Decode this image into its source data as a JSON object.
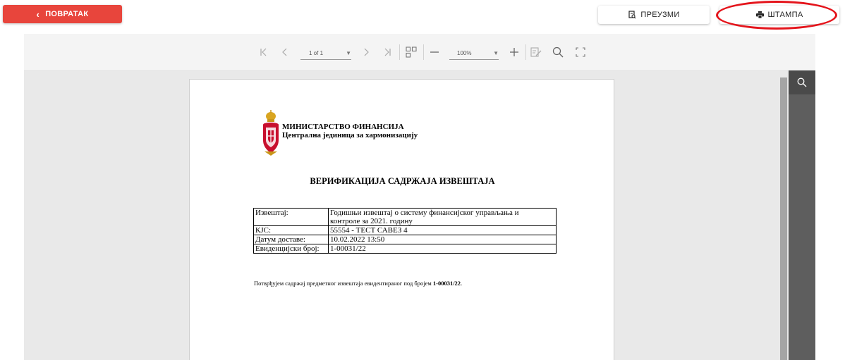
{
  "header": {
    "back_label": "ПОВРАТАК",
    "download_label": "ПРЕУЗМИ",
    "print_label": "ШТАМПА"
  },
  "toolbar": {
    "page_indicator": "1 of 1",
    "zoom_level": "100%",
    "icons": [
      "first-page-icon",
      "prev-page-icon",
      "next-page-icon",
      "last-page-icon",
      "thumbnails-icon",
      "zoom-out-icon",
      "zoom-in-icon",
      "annotate-icon",
      "search-icon",
      "fullscreen-icon"
    ]
  },
  "document": {
    "ministry_name": "МИНИСТАРСТВО ФИНАНСИЈА",
    "unit_name": "Централна јединица за хармонизацију",
    "title": "ВЕРИФИКАЦИЈА САДРЖАЈА ИЗВЕШТАЈА",
    "table": [
      {
        "label": "Извештај:",
        "value_line1": "Годишњи извештај о систему финансијског управљања и",
        "value_line2": "контроле за 2021. годину"
      },
      {
        "label": "КЈС:",
        "value": "55554 - ТЕСТ САВЕЗ 4"
      },
      {
        "label": "Датум доставе:",
        "value": "10.02.2022 13:50"
      },
      {
        "label": "Евиденцијски број:",
        "value": "1-00031/22"
      }
    ],
    "confirmation_text": "Потврђујем садржај предметног извештаја евидентираног под бројем ",
    "confirmation_number": "1-00031/22",
    "confirmation_end": "."
  },
  "colors": {
    "accent_red": "#e8453c",
    "highlight_ellipse": "#e4141b",
    "side_panel": "#5e5e5e"
  }
}
